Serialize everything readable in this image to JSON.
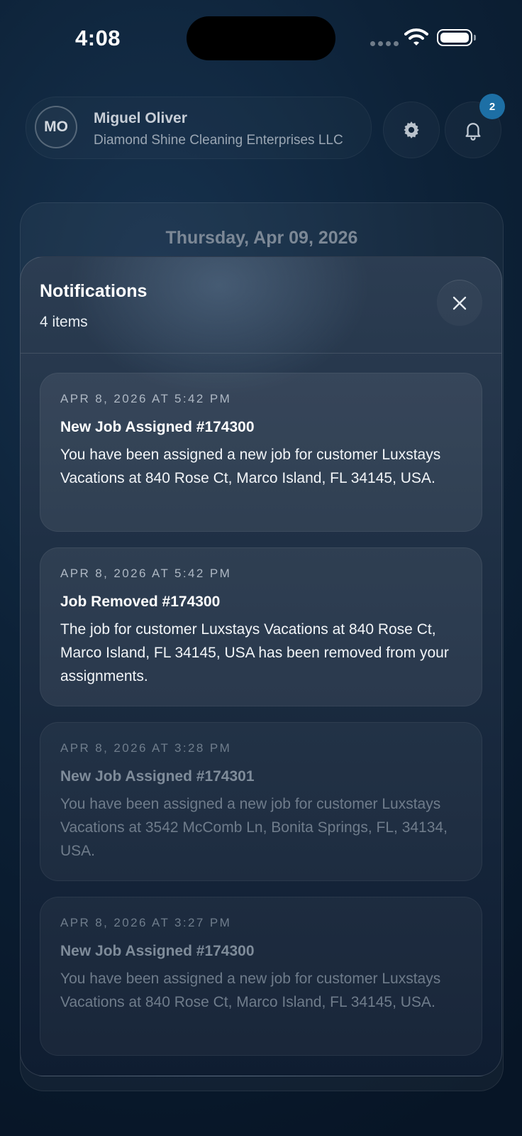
{
  "status_bar": {
    "time": "4:08",
    "icons": [
      "cellular-icon",
      "wifi-icon",
      "battery-icon"
    ]
  },
  "header": {
    "avatar_initials": "MO",
    "user_name": "Miguel Oliver",
    "company": "Diamond Shine Cleaning Enterprises LLC",
    "notification_badge_count": "2",
    "settings_icon": "gear-icon",
    "bell_icon": "bell-icon"
  },
  "main": {
    "date": "Thursday, Apr 09, 2026"
  },
  "notifications_panel": {
    "title": "Notifications",
    "count_label": "4 items",
    "close_icon": "close-icon",
    "items": [
      {
        "date": "APR 8, 2026 AT 5:42 PM",
        "title": "New Job Assigned #174300",
        "body": "You have been assigned a new job for customer Luxstays Vacations at 840 Rose Ct, Marco Island, FL 34145, USA.",
        "read": false
      },
      {
        "date": "APR 8, 2026 AT 5:42 PM",
        "title": "Job Removed #174300",
        "body": "The job for customer Luxstays Vacations at 840 Rose Ct, Marco Island, FL 34145, USA has been removed from your assignments.",
        "read": false
      },
      {
        "date": "APR 8, 2026 AT 3:28 PM",
        "title": "New Job Assigned #174301",
        "body": "You have been assigned a new job for customer Luxstays Vacations at 3542 McComb Ln, Bonita Springs, FL, 34134, USA.",
        "read": true
      },
      {
        "date": "APR 8, 2026 AT 3:27 PM",
        "title": "New Job Assigned #174300",
        "body": "You have been assigned a new job for customer Luxstays Vacations at 840 Rose Ct, Marco Island, FL 34145, USA.",
        "read": true
      }
    ]
  },
  "colors": {
    "accent_badge": "#1d6fa5",
    "background": "#0d2238"
  }
}
